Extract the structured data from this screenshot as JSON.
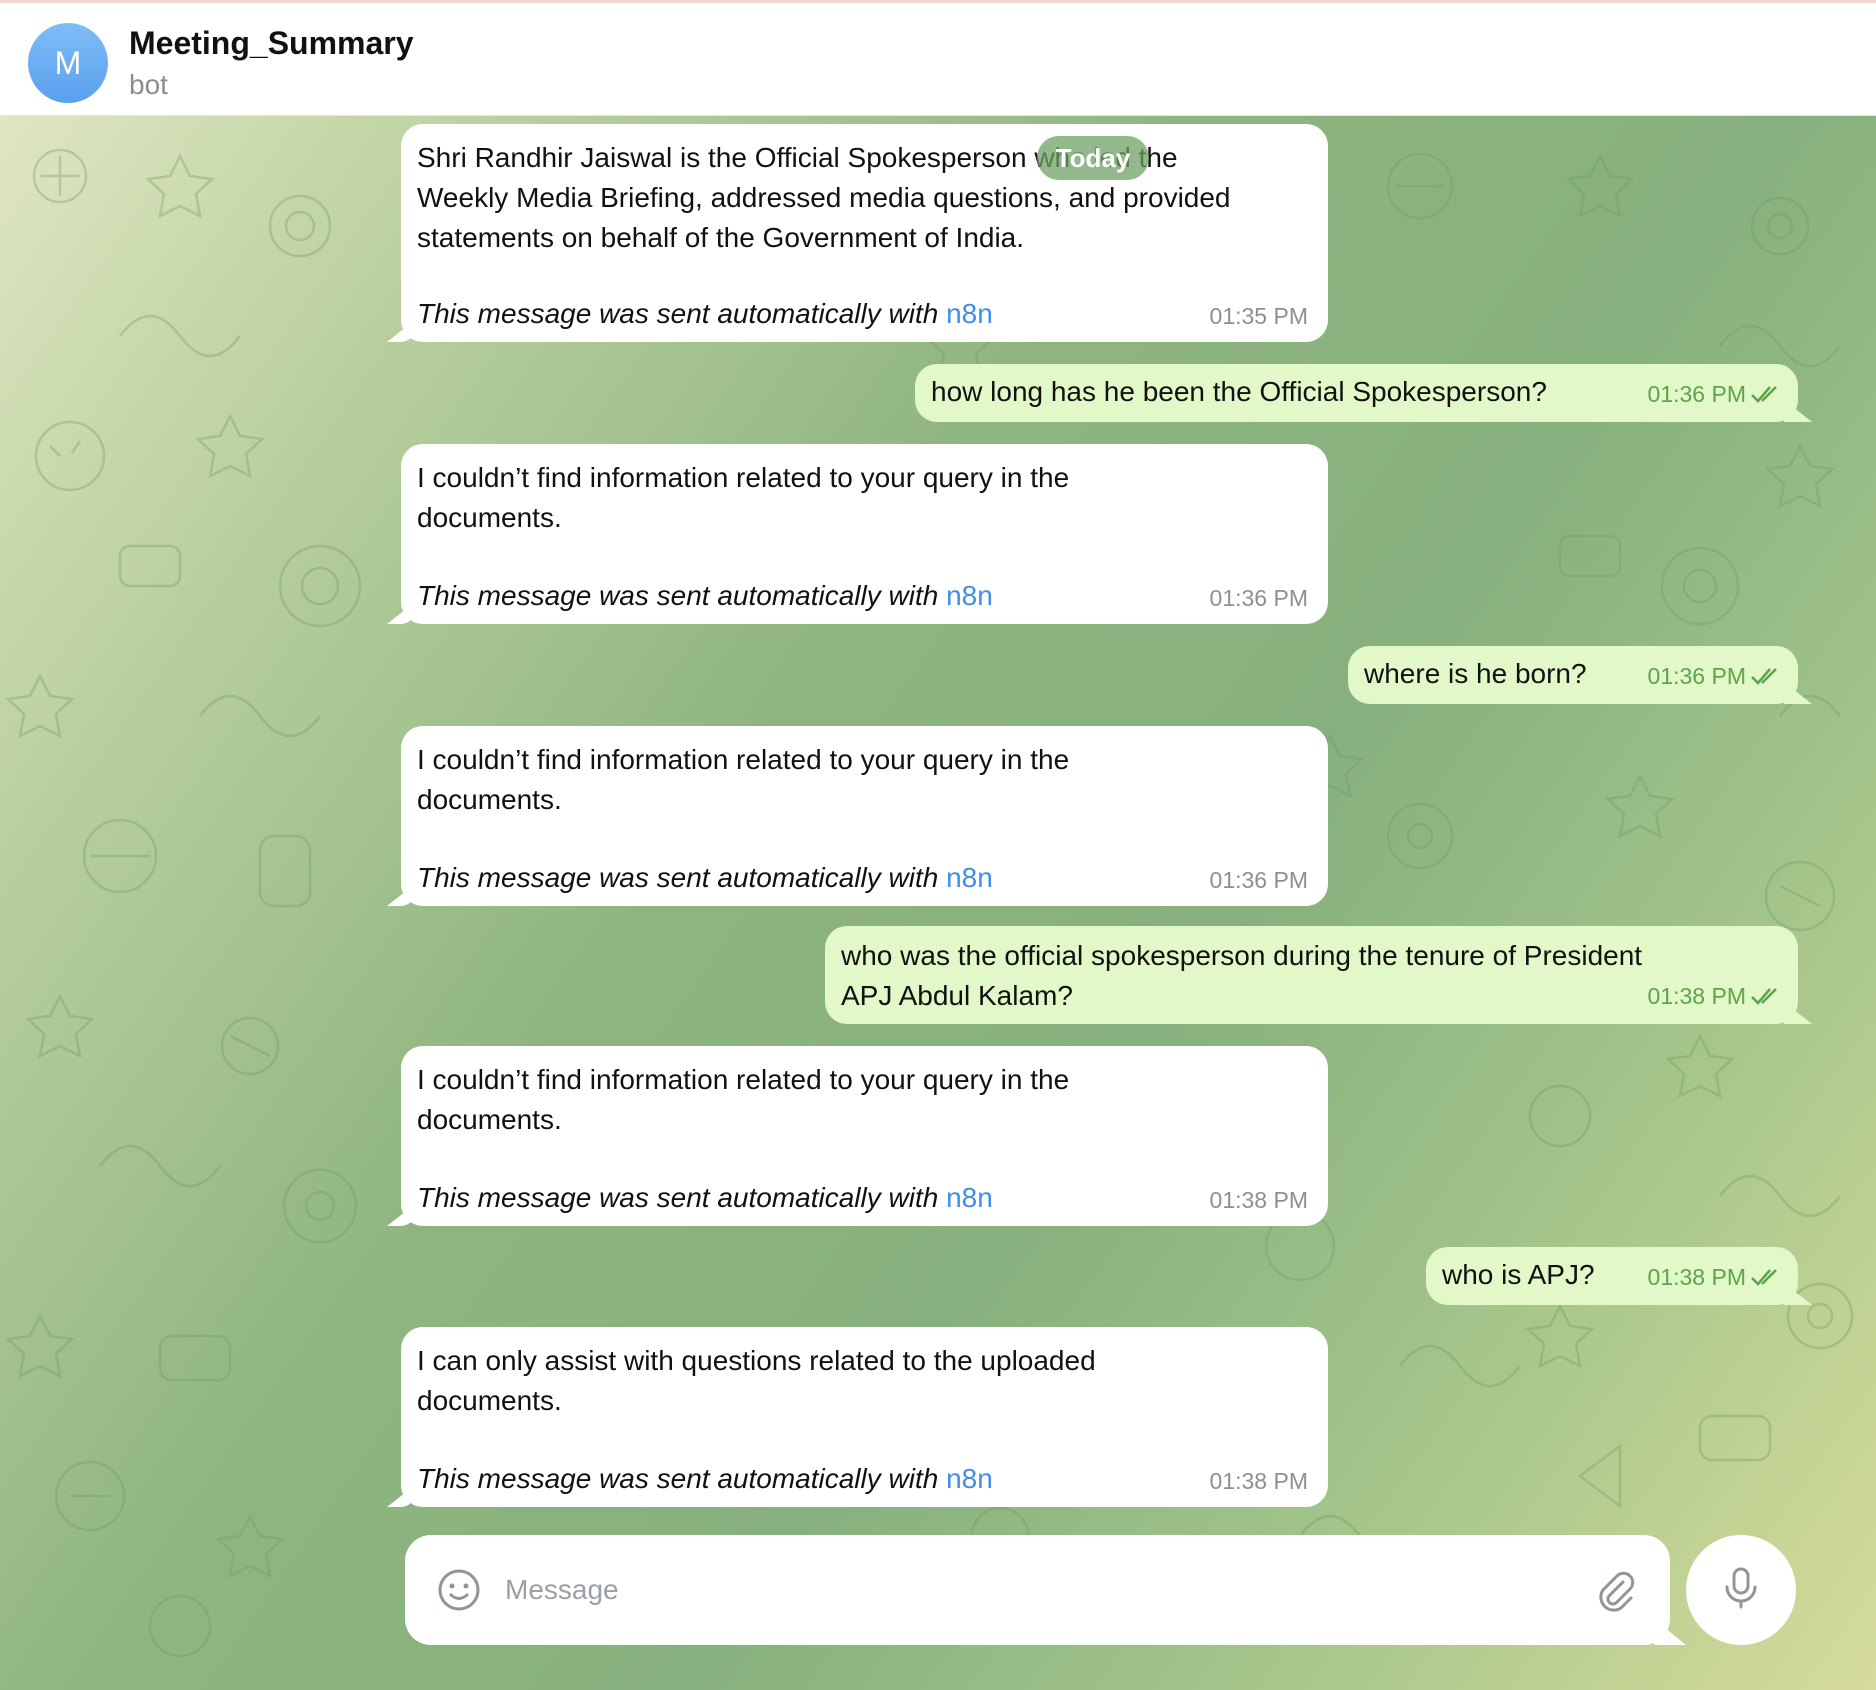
{
  "header": {
    "avatar_letter": "M",
    "title": "Meeting_Summary",
    "subtitle": "bot"
  },
  "date_badge": "Today",
  "auto_note": {
    "text": "This message was sent automatically with ",
    "link": "n8n"
  },
  "messages": [
    {
      "direction": "incoming",
      "text": "Shri Randhir Jaiswal is the Official Spokesperson who led the\nWeekly Media Briefing, addressed media questions, and provided\nstatements on behalf of the Government of India.",
      "time": "01:35 PM"
    },
    {
      "direction": "outgoing",
      "text": "how long has he been the Official Spokesperson?",
      "time": "01:36 PM"
    },
    {
      "direction": "incoming",
      "text": "I couldn’t find information related to your query in the\ndocuments.",
      "time": "01:36 PM"
    },
    {
      "direction": "outgoing",
      "text": "where is he born?",
      "time": "01:36 PM"
    },
    {
      "direction": "incoming",
      "text": "I couldn’t find information related to your query in the\ndocuments.",
      "time": "01:36 PM"
    },
    {
      "direction": "outgoing",
      "text": "who was the official spokesperson during the tenure of President\nAPJ Abdul Kalam?",
      "time": "01:38 PM"
    },
    {
      "direction": "incoming",
      "text": "I couldn’t find information related to your query in the\ndocuments.",
      "time": "01:38 PM"
    },
    {
      "direction": "outgoing",
      "text": "who is APJ?",
      "time": "01:38 PM"
    },
    {
      "direction": "incoming",
      "text": "I can only assist with questions related to the uploaded\ndocuments.",
      "time": "01:38 PM"
    }
  ],
  "composer": {
    "placeholder": "Message",
    "emoji_icon": "smile-icon",
    "attach_icon": "paperclip-icon",
    "mic_icon": "microphone-icon"
  },
  "colors": {
    "incoming_bubble": "#ffffff",
    "outgoing_bubble": "#e3f8c8",
    "outgoing_time": "#5da44a",
    "link": "#3f8fe6",
    "avatar": "#6aaef3"
  }
}
